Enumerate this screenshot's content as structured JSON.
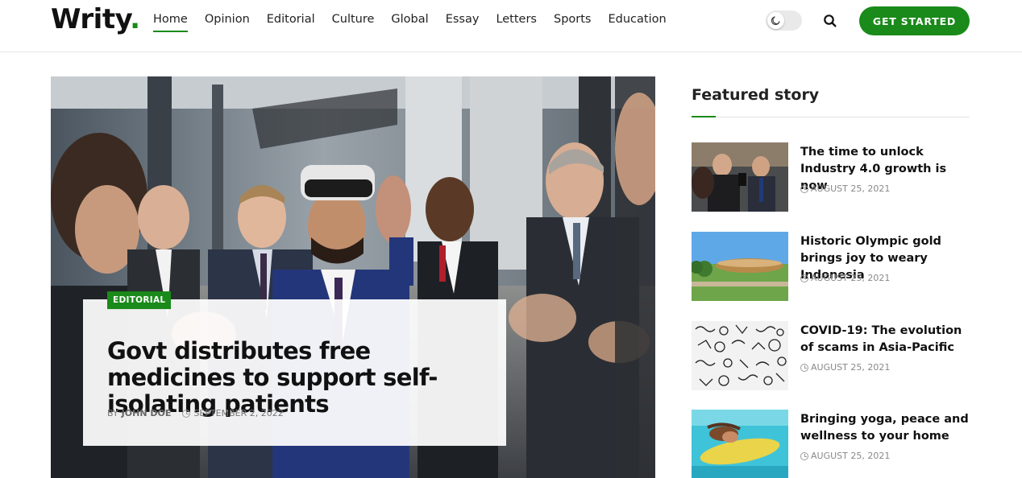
{
  "brand": {
    "name": "Writy",
    "dot": ".",
    "accent": "#1a8a1a"
  },
  "nav": {
    "items": [
      {
        "label": "Home",
        "active": true
      },
      {
        "label": "Opinion"
      },
      {
        "label": "Editorial"
      },
      {
        "label": "Culture"
      },
      {
        "label": "Global"
      },
      {
        "label": "Essay"
      },
      {
        "label": "Letters"
      },
      {
        "label": "Sports"
      },
      {
        "label": "Education"
      }
    ]
  },
  "header": {
    "theme_toggle_icon": "moon-icon",
    "search_icon": "search-icon",
    "cta_label": "GET STARTED"
  },
  "hero": {
    "category": "EDITORIAL",
    "title": "Govt distributes free medicines to support self-isolating patients",
    "by_label": "BY",
    "author": "JOHN DOE",
    "date": "SEPTEMBER 2, 2022"
  },
  "sidebar": {
    "title": "Featured story",
    "stories": [
      {
        "title": "The time to unlock Industry 4.0 growth is now",
        "date": "AUGUST 25, 2021"
      },
      {
        "title": "Historic Olympic gold brings joy to weary Indonesia",
        "date": "AUGUST 25, 2021"
      },
      {
        "title": "COVID-19: The evolution of scams in Asia-Pacific",
        "date": "AUGUST 25, 2021"
      },
      {
        "title": "Bringing yoga, peace and wellness to your home",
        "date": "AUGUST 25, 2021"
      }
    ]
  }
}
